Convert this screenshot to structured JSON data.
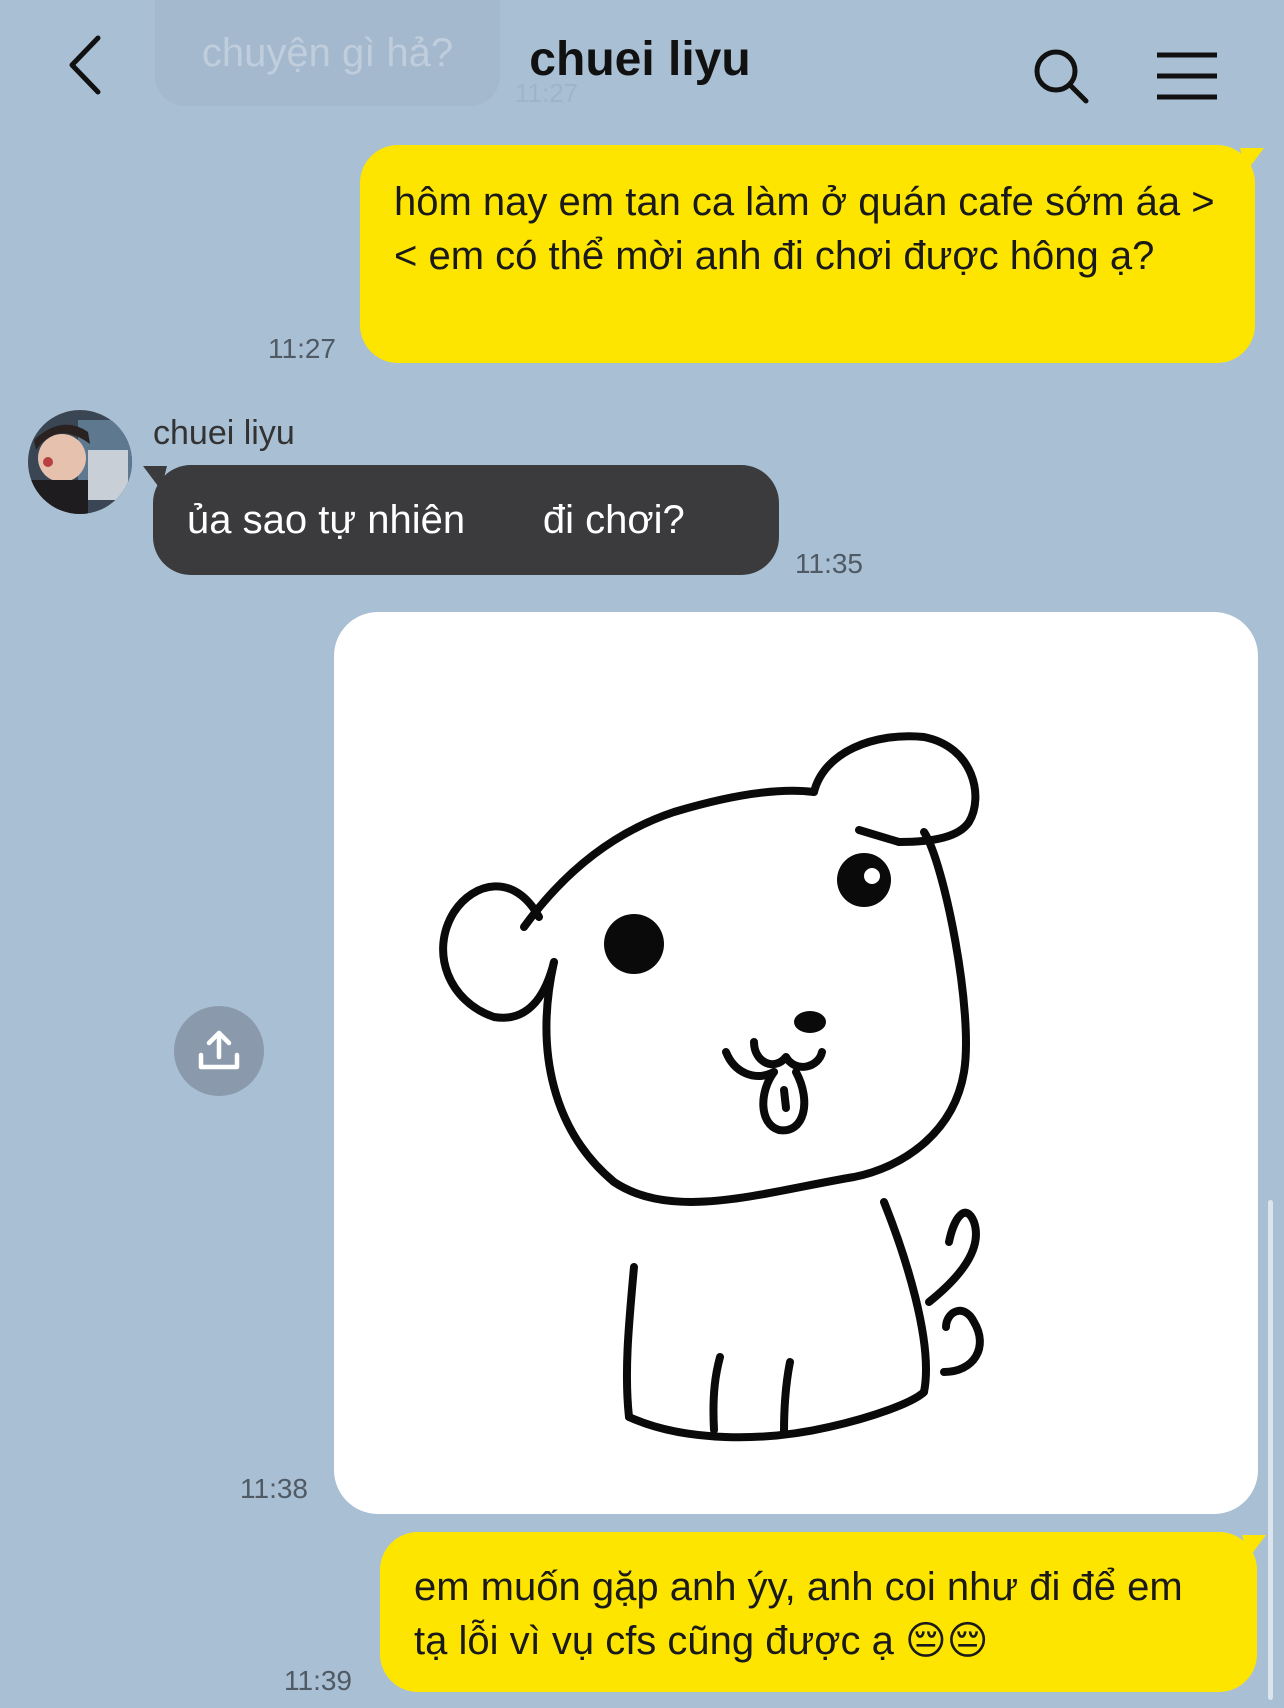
{
  "header": {
    "title": "chuei liyu",
    "faded_previous_message": "chuyện gì hả?",
    "faded_previous_time": "11:27"
  },
  "messages": [
    {
      "sender": "me",
      "text": "hôm nay em tan ca làm ở quán cafe sớm áa >< em có thể mời anh đi chơi được hông ạ?",
      "time": "11:27"
    },
    {
      "sender": "them",
      "sender_name": "chuei liyu",
      "text": "ủa sao tự nhiên       đi chơi?",
      "time": "11:35"
    },
    {
      "sender": "me",
      "type": "sticker",
      "sticker": "puppy-drawing",
      "time": "11:38"
    },
    {
      "sender": "me",
      "text": "em muốn gặp anh ýy, anh coi như đi để em tạ lỗi vì vụ cfs cũng được ạ 😔😔",
      "time": "11:39"
    }
  ],
  "colors": {
    "background": "#a9bfd4",
    "my_bubble": "#fee500",
    "their_bubble": "#3b3b3e",
    "share_button": "#8a9aac"
  },
  "icons": {
    "back": "chevron-left-icon",
    "search": "search-icon",
    "menu": "hamburger-menu-icon",
    "share": "share-upload-icon"
  }
}
